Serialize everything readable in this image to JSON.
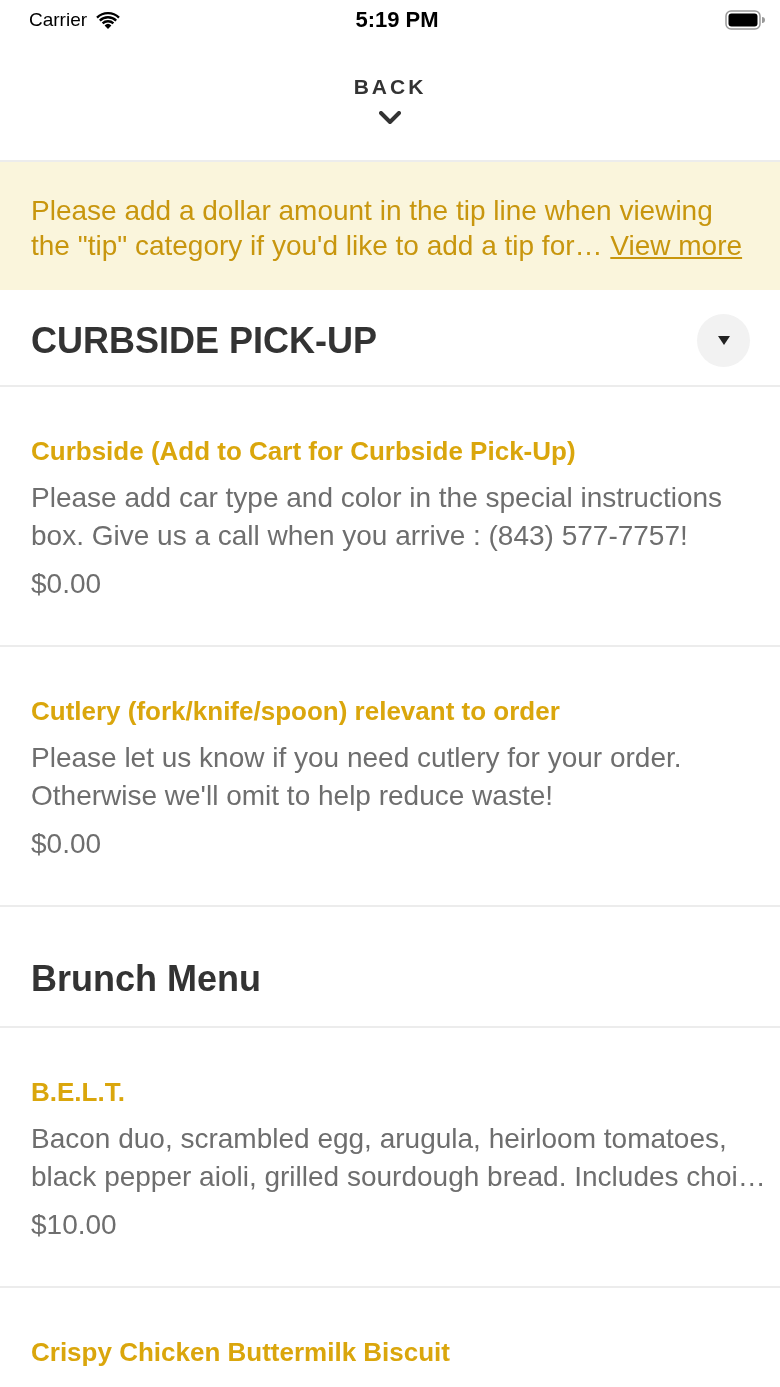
{
  "status_bar": {
    "carrier": "Carrier",
    "time": "5:19 PM"
  },
  "header": {
    "back_label": "BACK"
  },
  "notice": {
    "text": "Please add a dollar amount in the tip line when viewing the \"tip\" category if you'd like to add a tip for…",
    "link": "View more"
  },
  "sections": [
    {
      "title": "CURBSIDE PICK-UP",
      "kind": "dropdown",
      "items": [
        {
          "name": "Curbside (Add to Cart for Curbside Pick-Up)",
          "description": "Please add car type and color in the special instructions box. Give us a call when you arrive : (843) 577-7757!",
          "price": "$0.00"
        },
        {
          "name": "Cutlery (fork/knife/spoon) relevant to order",
          "description": "Please let us know if you need cutlery for your order. Otherwise we'll omit to help reduce waste!",
          "price": "$0.00"
        }
      ]
    },
    {
      "title": "Brunch Menu",
      "kind": "plain",
      "items": [
        {
          "name": "B.E.L.T.",
          "description": "Bacon duo, scrambled egg, arugula, heirloom tomatoes, black pepper aioli, grilled sourdough bread. Includes choi…",
          "price": "$10.00"
        },
        {
          "name": "Crispy Chicken Buttermilk Biscuit"
        }
      ]
    }
  ]
}
